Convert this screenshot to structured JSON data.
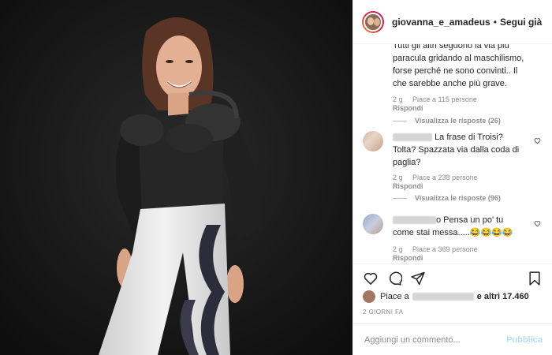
{
  "post": {
    "username": "giovanna_e_amadeus",
    "separator": "•",
    "follow_state": "Segui già"
  },
  "comments": [
    {
      "text_lines": [
        "Tutti gli altri seguono la via più",
        "paracula gridando al maschilismo,",
        "forse perché ne sono convinti.. Il",
        "che sarebbe anche più grave."
      ],
      "time": "2 g",
      "likes": "Piace a 115 persone",
      "reply": "Rispondi",
      "view_replies": "Visualizza le risposte (26)"
    },
    {
      "username_visible": "_____",
      "text_first": "La frase di Troisi?",
      "text_lines": [
        "Tolta? Spazzata via dalla coda di",
        "paglia?"
      ],
      "time": "2 g",
      "likes": "Piace a 238 persone",
      "reply": "Rispondi",
      "view_replies": "Visualizza le risposte (96)"
    },
    {
      "text_first": "o Pensa un po' tu",
      "text_lines": [
        "come stai messa.....😂😂😂😂"
      ],
      "time": "2 g",
      "likes": "Piace a 369 persone",
      "reply": "Rispondi"
    }
  ],
  "actions": {
    "like": "heart-icon",
    "comment": "comment-icon",
    "share": "share-icon",
    "save": "bookmark-icon"
  },
  "likes_summary": {
    "prefix": "Piace a",
    "suffix": "e altri 17.460"
  },
  "timestamp": "2 GIORNI FA",
  "add_comment": {
    "placeholder": "Aggiungi un commento...",
    "publish_label": "Pubblica"
  },
  "colors": {
    "link_disabled": "#b2dffc",
    "muted": "#8e8e8e",
    "text": "#262626"
  }
}
